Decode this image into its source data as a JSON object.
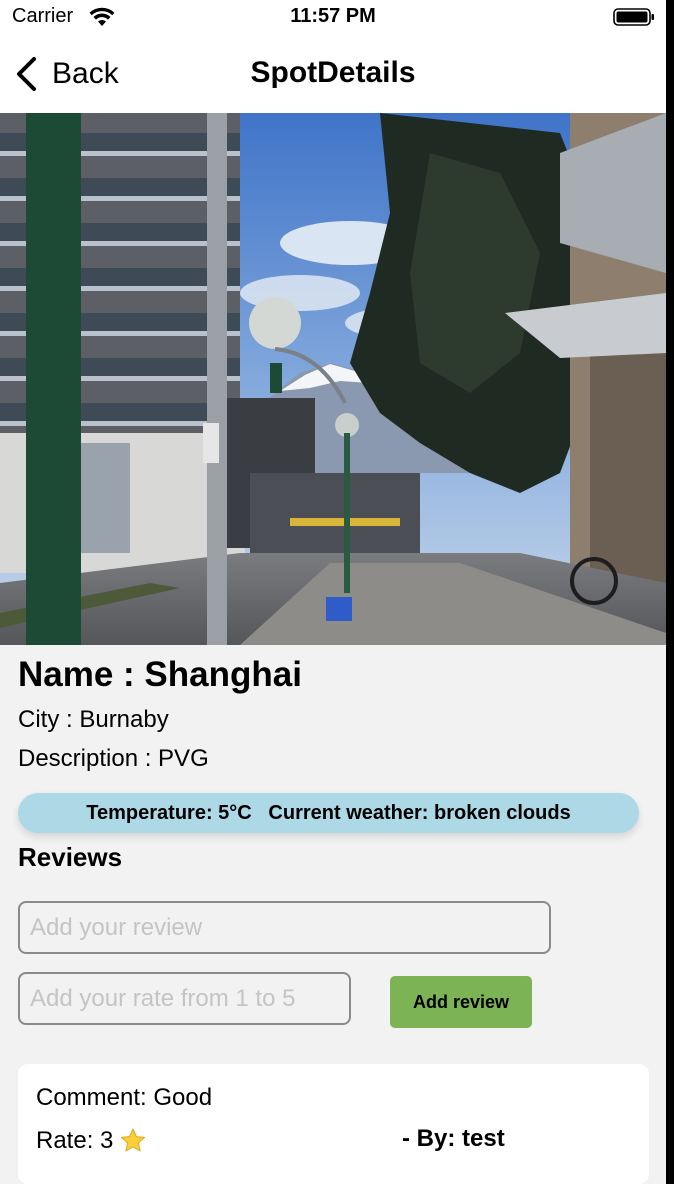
{
  "status_bar": {
    "carrier": "Carrier",
    "time": "11:57 PM",
    "icons": [
      "wifi-icon",
      "battery-icon"
    ]
  },
  "nav": {
    "back_label": "Back",
    "title": "SpotDetails",
    "back_icon": "chevron-left-icon"
  },
  "spot": {
    "name": "Name : Shanghai",
    "city": "City : Burnaby",
    "description": "Description : PVG"
  },
  "weather": {
    "temperature": "Temperature: 5°C",
    "current": "Current weather: broken clouds",
    "background": "#add8e6"
  },
  "reviews": {
    "title": "Reviews",
    "review_input": {
      "value": "",
      "placeholder": "Add your review"
    },
    "rate_input": {
      "value": "",
      "placeholder": "Add your rate from 1 to 5"
    },
    "add_button_label": "Add review",
    "add_button_color": "#7cb354",
    "items": [
      {
        "comment": "Comment: Good",
        "rate": "Rate: 3",
        "rate_icon": "star-icon",
        "by": "- By: test"
      }
    ]
  }
}
